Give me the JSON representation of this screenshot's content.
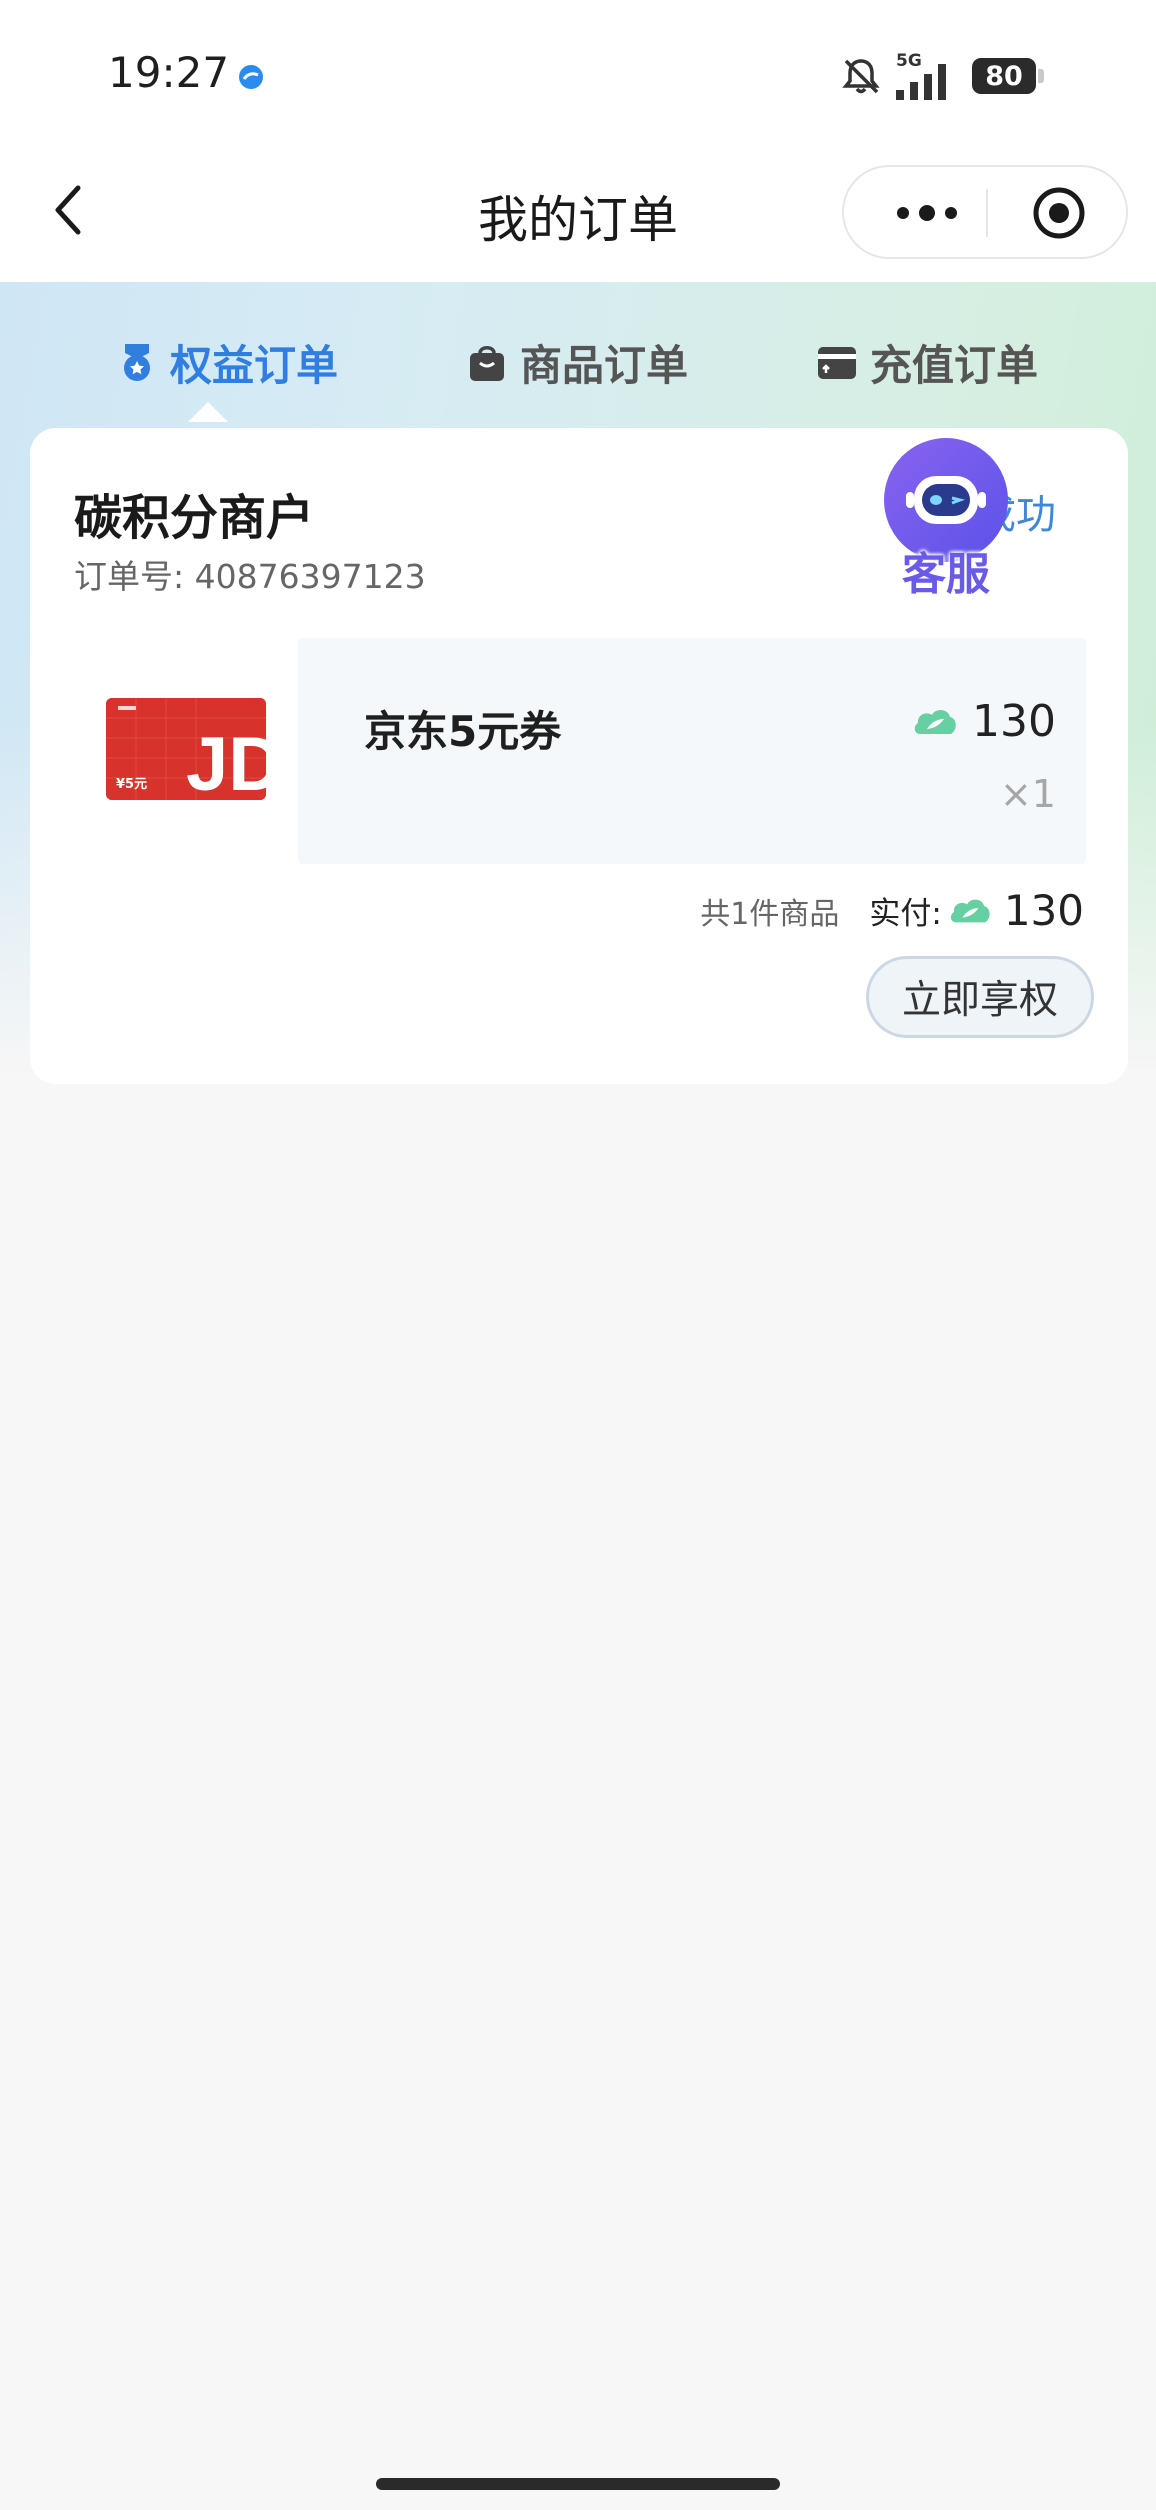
{
  "status_bar": {
    "time": "19:27",
    "network": "5G",
    "battery": "80"
  },
  "nav": {
    "title": "我的订单"
  },
  "tabs": [
    {
      "label": "权益订单",
      "icon": "medal-icon",
      "active": true
    },
    {
      "label": "商品订单",
      "icon": "shopping-bag-icon",
      "active": false
    },
    {
      "label": "充值订单",
      "icon": "card-icon",
      "active": false
    }
  ],
  "order": {
    "merchant": "碳积分商户",
    "order_no": "订单号: 40876397123",
    "status": "成功",
    "product": {
      "name": "京东5元券",
      "price": "130",
      "quantity": "×1",
      "thumb_text": "¥5元",
      "thumb_logo": "JD"
    },
    "summary": {
      "count": "共1件商品",
      "paid_label": "实付:",
      "paid_value": "130"
    },
    "action": "立即享权"
  },
  "floating": {
    "kefu_label": "客服"
  },
  "colors": {
    "accent": "#2f7ee0",
    "status": "#3f88d6",
    "points_green": "#5fcf9a",
    "kefu_purple": "#6a5ae8"
  }
}
